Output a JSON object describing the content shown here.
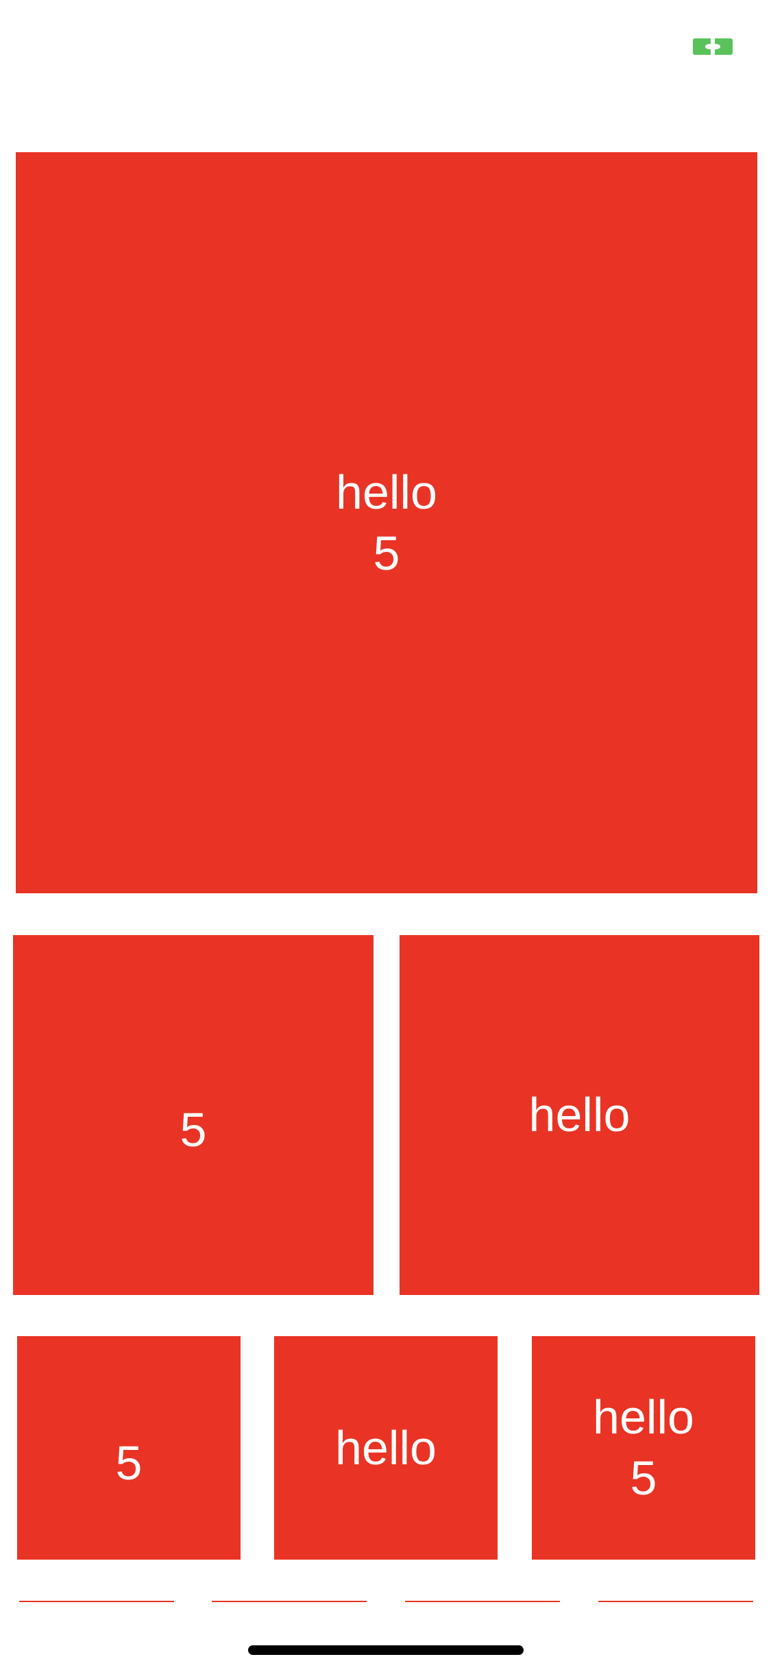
{
  "colors": {
    "tile_background": "#e93324",
    "tile_text": "#ffffff",
    "indicator": "#5ac25a",
    "page_background": "#ffffff"
  },
  "status": {
    "indicator_icon": "mirror-bracket-icon"
  },
  "tiles": {
    "large": {
      "line1": "hello",
      "line2": "5"
    },
    "mid_left": {
      "text": "5"
    },
    "mid_right": {
      "text": "hello"
    },
    "small_1": {
      "text": "5"
    },
    "small_2": {
      "text": "hello"
    },
    "small_3": {
      "line1": "hello",
      "line2": "5"
    }
  }
}
